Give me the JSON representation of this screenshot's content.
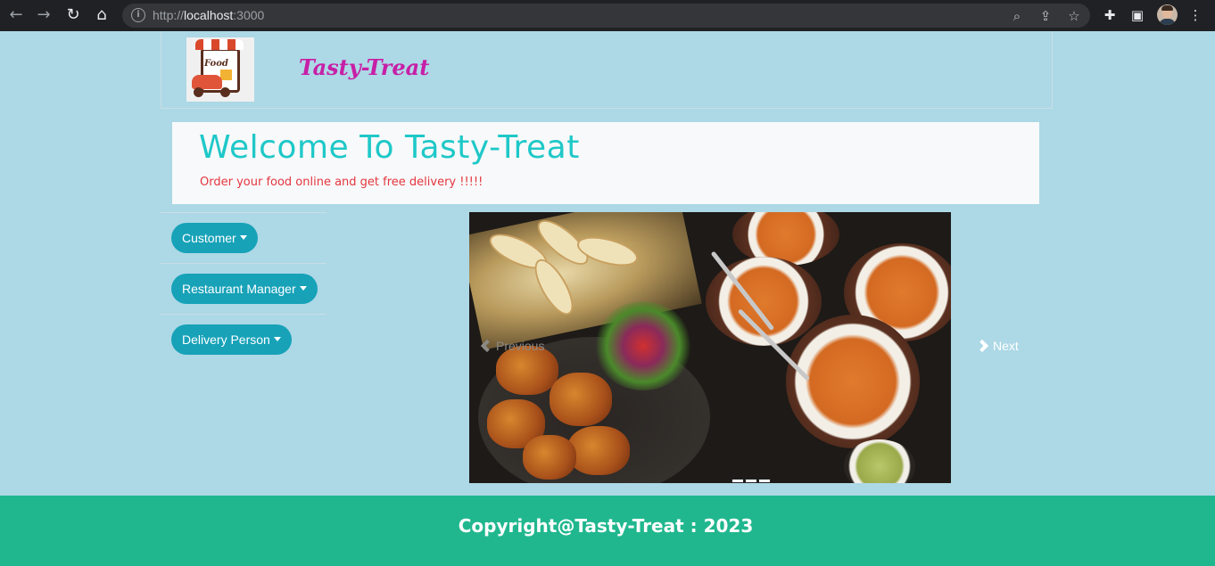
{
  "browser": {
    "url_prefix": "http://",
    "url_host": "localhost",
    "url_port": ":3000",
    "icons": [
      "back-icon",
      "forward-icon",
      "reload-icon",
      "home-icon",
      "info-icon",
      "zoom-icon",
      "share-icon",
      "bookmark-star-icon",
      "extensions-icon",
      "side-panel-icon",
      "profile-avatar",
      "menu-kebab-icon"
    ]
  },
  "navbar": {
    "brand": "Tasty-Treat",
    "logo_text": "Food"
  },
  "jumbotron": {
    "heading": "Welcome To Tasty-Treat",
    "tagline": "Order your food online and get free delivery !!!!!"
  },
  "sidebar": {
    "items": [
      {
        "label": "Customer"
      },
      {
        "label": "Restaurant Manager"
      },
      {
        "label": "Delivery Person"
      }
    ]
  },
  "carousel": {
    "prev_label": "Previous",
    "next_label": "Next",
    "slide_count": 3
  },
  "footer": {
    "copyright": "Copyright@Tasty-Treat : 2023"
  },
  "colors": {
    "page_bg": "#add8e6",
    "brand": "#c71fa6",
    "heading": "#1fc8c8",
    "tagline": "#e4363f",
    "pill": "#17a2b8",
    "footer": "#20b78e"
  }
}
